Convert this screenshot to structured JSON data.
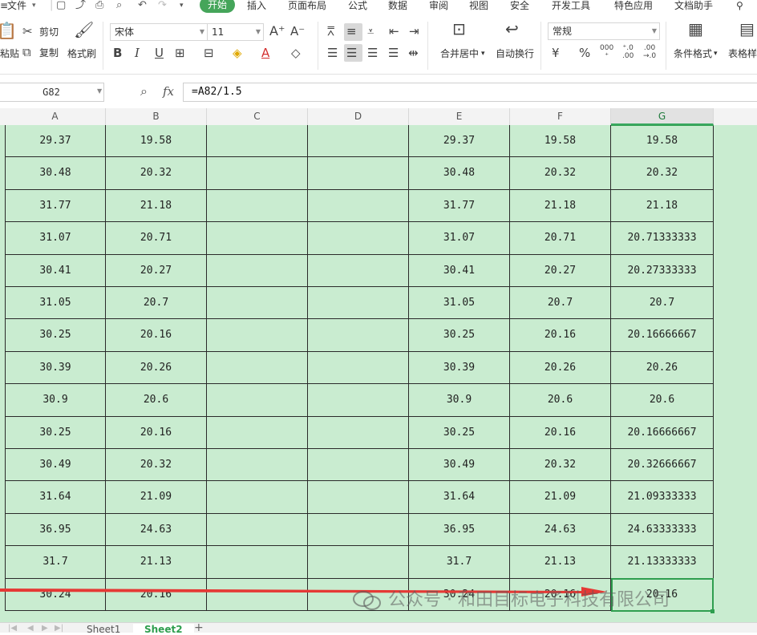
{
  "menu": {
    "file_label": "文件",
    "tabs": [
      "开始",
      "插入",
      "页面布局",
      "公式",
      "数据",
      "审阅",
      "视图",
      "安全",
      "开发工具",
      "特色应用",
      "文档助手"
    ],
    "active_tab": "开始"
  },
  "ribbon": {
    "paste_label": "粘贴",
    "cut_label": "剪切",
    "copy_label": "复制",
    "format_painter_label": "格式刷",
    "font_name": "宋体",
    "font_size": "11",
    "merge_center_label": "合并居中",
    "wrap_text_label": "自动换行",
    "number_format": "常规",
    "conditional_format_label": "条件格式",
    "table_style_label": "表格样",
    "search_icon": "search-icon"
  },
  "formula_bar": {
    "name_box": "G82",
    "fx_label": "fx",
    "formula": "=A82/1.5"
  },
  "columns": [
    "A",
    "B",
    "C",
    "D",
    "E",
    "F",
    "G"
  ],
  "selected_column": "G",
  "rows": [
    [
      "29.37",
      "19.58",
      "",
      "",
      "29.37",
      "19.58",
      "19.58"
    ],
    [
      "30.48",
      "20.32",
      "",
      "",
      "30.48",
      "20.32",
      "20.32"
    ],
    [
      "31.77",
      "21.18",
      "",
      "",
      "31.77",
      "21.18",
      "21.18"
    ],
    [
      "31.07",
      "20.71",
      "",
      "",
      "31.07",
      "20.71",
      "20.71333333"
    ],
    [
      "30.41",
      "20.27",
      "",
      "",
      "30.41",
      "20.27",
      "20.27333333"
    ],
    [
      "31.05",
      "20.7",
      "",
      "",
      "31.05",
      "20.7",
      "20.7"
    ],
    [
      "30.25",
      "20.16",
      "",
      "",
      "30.25",
      "20.16",
      "20.16666667"
    ],
    [
      "30.39",
      "20.26",
      "",
      "",
      "30.39",
      "20.26",
      "20.26"
    ],
    [
      "30.9",
      "20.6",
      "",
      "",
      "30.9",
      "20.6",
      "20.6"
    ],
    [
      "30.25",
      "20.16",
      "",
      "",
      "30.25",
      "20.16",
      "20.16666667"
    ],
    [
      "30.49",
      "20.32",
      "",
      "",
      "30.49",
      "20.32",
      "20.32666667"
    ],
    [
      "31.64",
      "21.09",
      "",
      "",
      "31.64",
      "21.09",
      "21.09333333"
    ],
    [
      "36.95",
      "24.63",
      "",
      "",
      "36.95",
      "24.63",
      "24.63333333"
    ],
    [
      "31.7",
      "21.13",
      "",
      "",
      "31.7",
      "21.13",
      "21.13333333"
    ],
    [
      "30.24",
      "20.16",
      "",
      "",
      "30.24",
      "20.16",
      "20.16"
    ]
  ],
  "watermark": "公众号 · 和田目标电子科技有限公司",
  "sheets": [
    "Sheet1",
    "Sheet2"
  ],
  "active_sheet": "Sheet2",
  "colors": {
    "accent": "#45a55a",
    "cell_fill": "#c9ecd0",
    "arrow": "#e53935",
    "selection": "#2f9e4f"
  }
}
